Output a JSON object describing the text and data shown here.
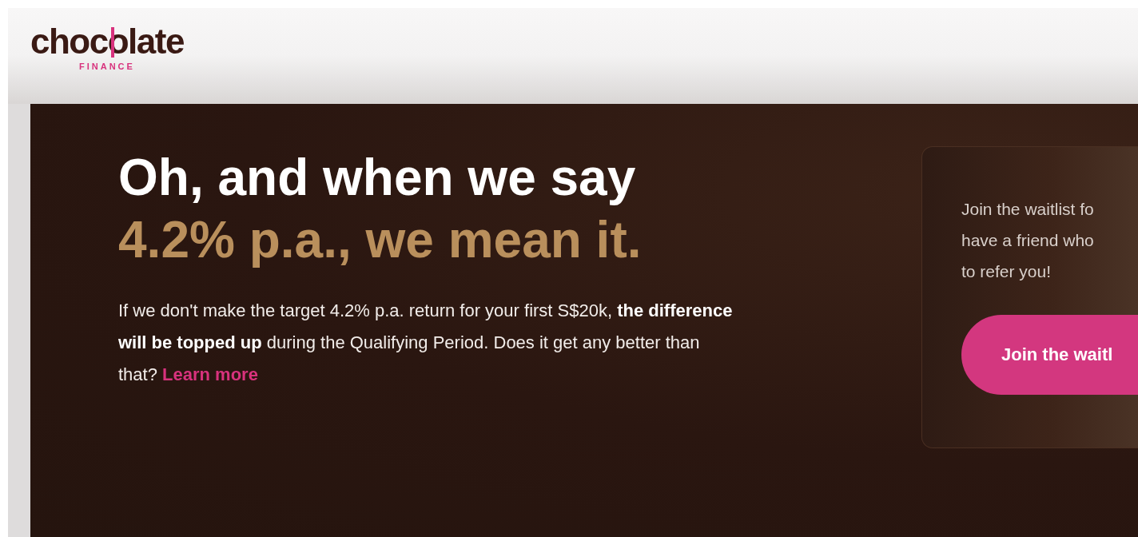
{
  "header": {
    "logo": {
      "wordmark": "chocolate",
      "tagline": "FINANCE"
    }
  },
  "hero": {
    "headline": "Oh, and when we say",
    "highlight": "4.2% p.a., we mean it.",
    "body": "If we don't make the target 4.2% p.a. return for your first S$20k, **the difference will be topped up** during the Qualifying Period. Does it get any better than that?",
    "link": "Learn more"
  },
  "waitlist_card": {
    "lines": [
      "Join the waitlist fo",
      "have a friend who",
      "to refer you!"
    ],
    "button": "Join the waitl"
  }
}
